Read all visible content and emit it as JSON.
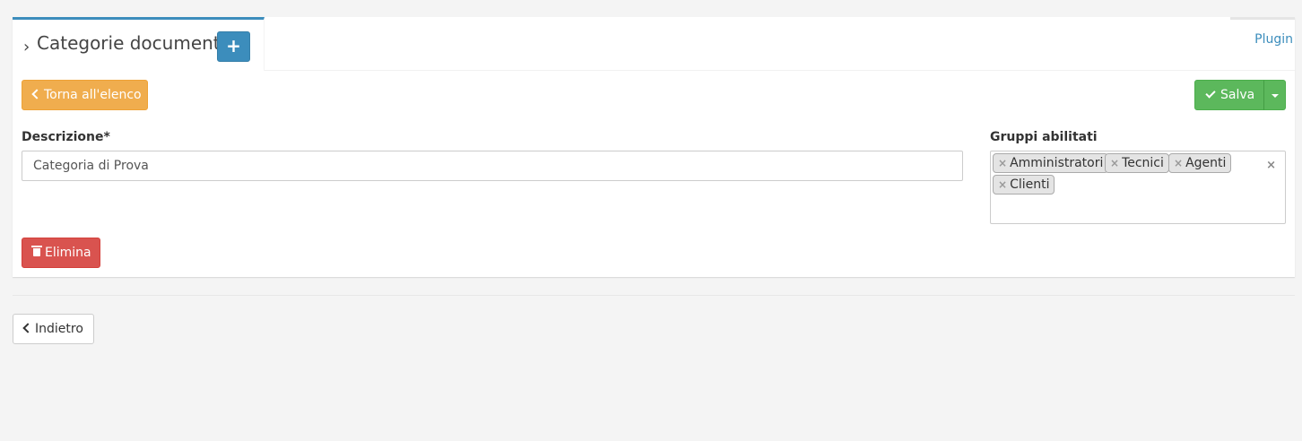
{
  "tab": {
    "title": "Categorie documenti",
    "chevron": "›",
    "add_button_label": "+",
    "plugin_tab_label": "Plugin"
  },
  "toolbar": {
    "back_to_list_label": "Torna all'elenco",
    "save_label": "Salva"
  },
  "form": {
    "description_label": "Descrizione*",
    "description_value": "Categoria di Prova",
    "groups_label": "Gruppi abilitati",
    "groups": [
      {
        "label": "Amministratori"
      },
      {
        "label": "Tecnici"
      },
      {
        "label": "Agenti"
      },
      {
        "label": "Clienti"
      }
    ],
    "clear_symbol": "×",
    "chip_remove_symbol": "×"
  },
  "actions": {
    "delete_label": "Elimina",
    "back_label": "Indietro"
  },
  "colors": {
    "primary": "#3c8dbc",
    "warning": "#f0ad4e",
    "success": "#5cb85c",
    "danger": "#d9534f"
  },
  "icons": {
    "back_icon": "chevron-left-icon",
    "save_icon": "check-icon",
    "delete_icon": "trash-icon",
    "dropdown_icon": "caret-down-icon"
  }
}
